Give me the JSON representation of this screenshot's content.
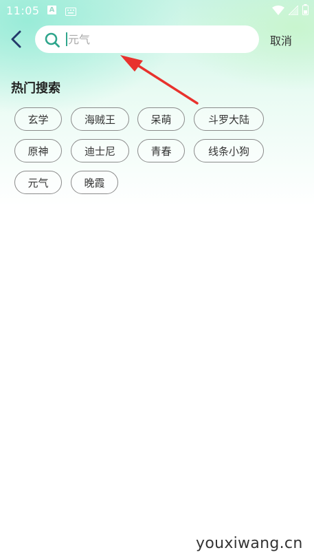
{
  "status_bar": {
    "time": "11:05",
    "left_icons": [
      "a-notification-icon",
      "keyboard-icon"
    ],
    "right_icons": [
      "wifi-icon",
      "signal-icon",
      "battery-icon"
    ]
  },
  "header": {
    "back_icon": "chevron-left-icon",
    "search": {
      "icon": "search-icon",
      "value": "",
      "placeholder": "元气"
    },
    "cancel_label": "取消"
  },
  "hot_search": {
    "title": "热门搜索",
    "tags": [
      "玄学",
      "海贼王",
      "呆萌",
      "斗罗大陆",
      "原神",
      "迪士尼",
      "青春",
      "线条小狗",
      "元气",
      "晚霞"
    ]
  },
  "watermark": "youxiwang.cn",
  "colors": {
    "accent": "#2fa58c",
    "gradient_top": "#c9f4e6",
    "arrow": "#e8322d"
  }
}
